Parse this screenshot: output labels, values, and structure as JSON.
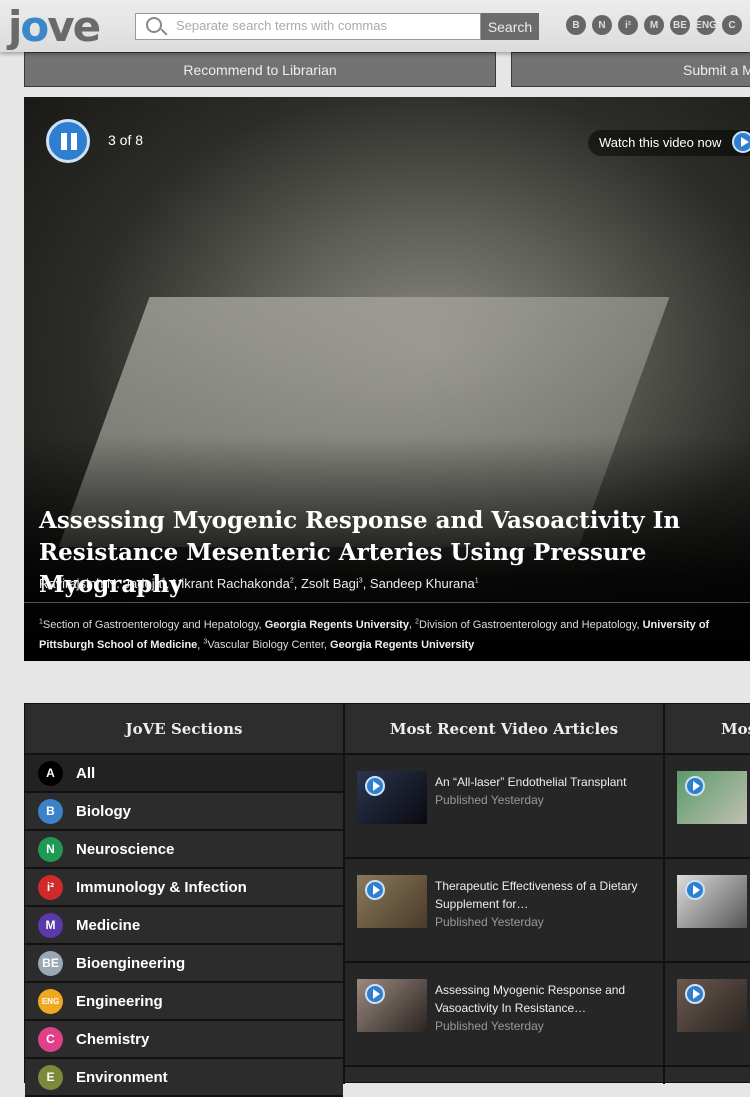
{
  "header": {
    "logo": "jove",
    "search_placeholder": "Separate search terms with commas",
    "search_button": "Search",
    "section_icons": [
      {
        "label": "B",
        "name": "biology"
      },
      {
        "label": "N",
        "name": "neuroscience"
      },
      {
        "label": "i²",
        "name": "immunology"
      },
      {
        "label": "M",
        "name": "medicine"
      },
      {
        "label": "BE",
        "name": "bioengineering"
      },
      {
        "label": "ENG",
        "name": "engineering"
      },
      {
        "label": "C",
        "name": "chemistry"
      }
    ]
  },
  "actions": {
    "recommend": "Recommend to Librarian",
    "submit": "Submit a M"
  },
  "video": {
    "counter": "3 of 8",
    "watch": "Watch this video now",
    "title": "Assessing Myogenic Response and Vasoactivity In Resistance Mesenteric Arteries Using Pressure Myography",
    "authors": [
      {
        "name": "Ravirajsinh N. Jadeja",
        "sup": "1"
      },
      {
        "name": "Vikrant Rachakonda",
        "sup": "2"
      },
      {
        "name": "Zsolt Bagi",
        "sup": "3"
      },
      {
        "name": "Sandeep Khurana",
        "sup": "1"
      }
    ],
    "affiliations": [
      {
        "sup": "1",
        "dept": "Section of Gastroenterology and Hepatology, ",
        "inst": "Georgia Regents University"
      },
      {
        "sup": "2",
        "dept": "Division of Gastroenterology and Hepatology, ",
        "inst": "University of Pittsburgh School of Medicine"
      },
      {
        "sup": "3",
        "dept": "Vascular Biology Center, ",
        "inst": "Georgia Regents University"
      }
    ]
  },
  "sections": {
    "heading": "JoVE Sections",
    "items": [
      {
        "badge": "A",
        "label": "All",
        "color": "#000000"
      },
      {
        "badge": "B",
        "label": "Biology",
        "color": "#3b82c8"
      },
      {
        "badge": "N",
        "label": "Neuroscience",
        "color": "#1f9a55"
      },
      {
        "badge": "i²",
        "label": "Immunology & Infection",
        "color": "#d02a2a"
      },
      {
        "badge": "M",
        "label": "Medicine",
        "color": "#5a3aa8"
      },
      {
        "badge": "BE",
        "label": "Bioengineering",
        "color": "#9aa8b3"
      },
      {
        "badge": "ENG",
        "label": "Engineering",
        "color": "#f0a820"
      },
      {
        "badge": "C",
        "label": "Chemistry",
        "color": "#e0408a"
      },
      {
        "badge": "E",
        "label": "Environment",
        "color": "#7a8a3a"
      }
    ]
  },
  "recent": {
    "heading": "Most Recent Video Articles",
    "items": [
      {
        "title": "An “All-laser” Endothelial Transplant",
        "published": "Published Yesterday"
      },
      {
        "title": "Therapeutic Effectiveness of a Dietary Supplement for…",
        "published": "Published Yesterday"
      },
      {
        "title": "Assessing Myogenic Response and Vasoactivity In Resistance…",
        "published": "Published Yesterday"
      }
    ]
  },
  "third": {
    "heading": "Mos"
  }
}
